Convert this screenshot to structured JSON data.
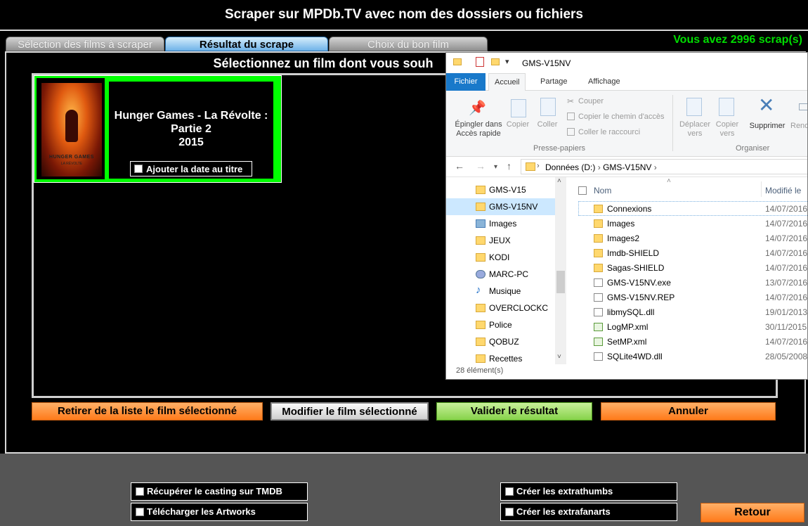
{
  "app": {
    "title": "Scraper sur MPDb.TV avec nom des dossiers ou fichiers",
    "scrap_count": "Vous avez 2996 scrap(s)"
  },
  "tabs": [
    {
      "label": "Sélection des films à scraper",
      "active": false
    },
    {
      "label": "Résultat du scrape",
      "active": true
    },
    {
      "label": "Choix du bon film",
      "active": false
    }
  ],
  "panel": {
    "heading": "Sélectionnez un film dont vous souh"
  },
  "film": {
    "title_line1": "Hunger Games - La Révolte :",
    "title_line2": "Partie 2",
    "year": "2015",
    "poster_title": "HUNGER GAMES",
    "poster_subtitle": "LA RÉVOLTE",
    "date_checkbox_label": "Ajouter la date au titre",
    "date_checkbox_checked": false
  },
  "actions": {
    "retirer": "Retirer de la liste le film sélectionné",
    "modifier": "Modifier le film sélectionné",
    "valider": "Valider le résultat",
    "annuler": "Annuler"
  },
  "options": {
    "casting": "Récupérer le casting sur TMDB",
    "artworks": "Télécharger les Artworks",
    "extrathumbs": "Créer les extrathumbs",
    "extrafanarts": "Créer les extrafanarts",
    "retour": "Retour"
  },
  "explorer": {
    "title": "GMS-V15NV",
    "ribbon_tabs": [
      "Fichier",
      "Accueil",
      "Partage",
      "Affichage"
    ],
    "ribbon": {
      "epingler": "Épingler dans",
      "epingler2": "Accès rapide",
      "copier": "Copier",
      "coller": "Coller",
      "couper": "Couper",
      "copier_chemin": "Copier le chemin d'accès",
      "coller_raccourci": "Coller le raccourci",
      "presse_papiers": "Presse-papiers",
      "deplacer": "Déplacer",
      "deplacer2": "vers",
      "copier_vers": "Copier",
      "copier_vers2": "vers",
      "supprimer": "Supprimer",
      "renommer": "Renommer",
      "organiser": "Organiser"
    },
    "address": {
      "drive": "Données (D:)",
      "folder": "GMS-V15NV"
    },
    "nav_items": [
      "GMS-V15",
      "GMS-V15NV",
      "Images",
      "JEUX",
      "KODI",
      "MARC-PC",
      "Musique",
      "OVERCLOCKC",
      "Police",
      "QOBUZ",
      "Recettes"
    ],
    "columns": {
      "name": "Nom",
      "date": "Modifié le"
    },
    "files": [
      {
        "name": "Connexions",
        "date": "14/07/2016",
        "type": "folder"
      },
      {
        "name": "Images",
        "date": "14/07/2016",
        "type": "folder"
      },
      {
        "name": "Images2",
        "date": "14/07/2016",
        "type": "folder"
      },
      {
        "name": "Imdb-SHIELD",
        "date": "14/07/2016",
        "type": "folder"
      },
      {
        "name": "Sagas-SHIELD",
        "date": "14/07/2016",
        "type": "folder"
      },
      {
        "name": "GMS-V15NV.exe",
        "date": "13/07/2016",
        "type": "doc"
      },
      {
        "name": "GMS-V15NV.REP",
        "date": "14/07/2016",
        "type": "doc"
      },
      {
        "name": "libmySQL.dll",
        "date": "19/01/2013",
        "type": "doc"
      },
      {
        "name": "LogMP.xml",
        "date": "30/11/2015",
        "type": "xml"
      },
      {
        "name": "SetMP.xml",
        "date": "14/07/2016",
        "type": "xml"
      },
      {
        "name": "SQLite4WD.dll",
        "date": "28/05/2008",
        "type": "doc"
      }
    ],
    "status": "28 élément(s)"
  }
}
